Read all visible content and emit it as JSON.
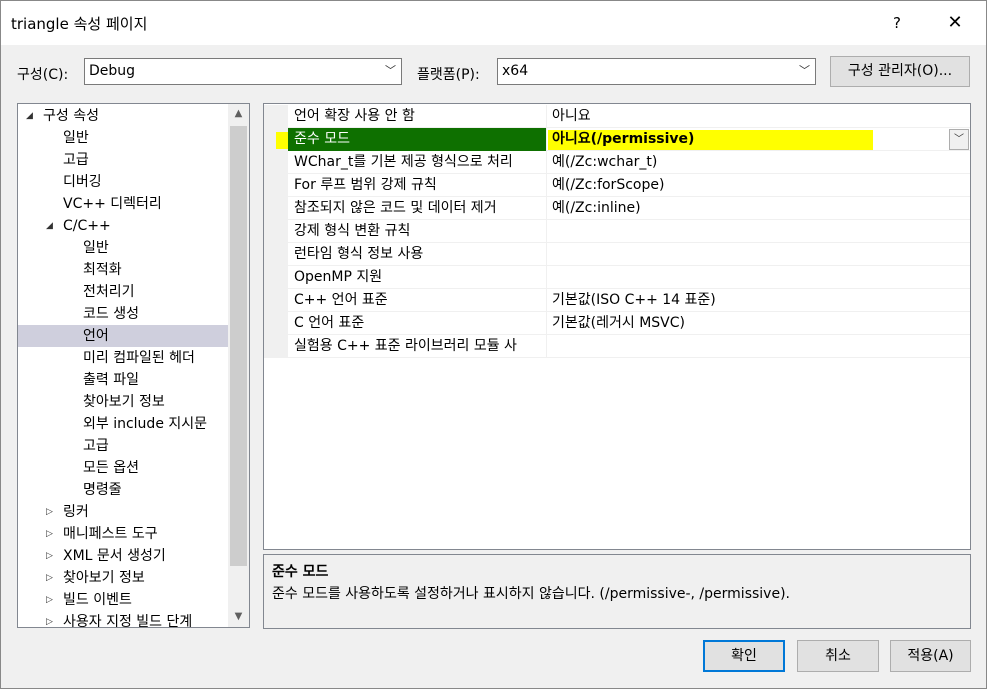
{
  "window": {
    "title": "triangle 속성 페이지",
    "help_label": "?",
    "close_label": "✕"
  },
  "config_bar": {
    "config_label": "구성(C):",
    "config_value": "Debug",
    "platform_label": "플랫폼(P):",
    "platform_value": "x64",
    "manager_button": "구성 관리자(O)..."
  },
  "tree": {
    "items": [
      {
        "label": "구성 속성",
        "level": 0,
        "expander": "◢"
      },
      {
        "label": "일반",
        "level": 1,
        "expander": ""
      },
      {
        "label": "고급",
        "level": 1,
        "expander": ""
      },
      {
        "label": "디버깅",
        "level": 1,
        "expander": ""
      },
      {
        "label": "VC++ 디렉터리",
        "level": 1,
        "expander": ""
      },
      {
        "label": "C/C++",
        "level": 1,
        "expander": "◢"
      },
      {
        "label": "일반",
        "level": 2,
        "expander": ""
      },
      {
        "label": "최적화",
        "level": 2,
        "expander": ""
      },
      {
        "label": "전처리기",
        "level": 2,
        "expander": ""
      },
      {
        "label": "코드 생성",
        "level": 2,
        "expander": ""
      },
      {
        "label": "언어",
        "level": 2,
        "expander": "",
        "selected": true
      },
      {
        "label": "미리 컴파일된 헤더",
        "level": 2,
        "expander": ""
      },
      {
        "label": "출력 파일",
        "level": 2,
        "expander": ""
      },
      {
        "label": "찾아보기 정보",
        "level": 2,
        "expander": ""
      },
      {
        "label": "외부 include 지시문",
        "level": 2,
        "expander": ""
      },
      {
        "label": "고급",
        "level": 2,
        "expander": ""
      },
      {
        "label": "모든 옵션",
        "level": 2,
        "expander": ""
      },
      {
        "label": "명령줄",
        "level": 2,
        "expander": ""
      },
      {
        "label": "링커",
        "level": 1,
        "expander": "▷"
      },
      {
        "label": "매니페스트 도구",
        "level": 1,
        "expander": "▷"
      },
      {
        "label": "XML 문서 생성기",
        "level": 1,
        "expander": "▷"
      },
      {
        "label": "찾아보기 정보",
        "level": 1,
        "expander": "▷"
      },
      {
        "label": "빌드 이벤트",
        "level": 1,
        "expander": "▷"
      },
      {
        "label": "사용자 지정 빌드 단계",
        "level": 1,
        "expander": "▷"
      }
    ]
  },
  "properties": {
    "rows": [
      {
        "name": "언어 확장 사용 안 함",
        "value": "아니요"
      },
      {
        "name": "준수 모드",
        "value": "아니요(/permissive)",
        "selected": true
      },
      {
        "name": "WChar_t를 기본 제공 형식으로 처리",
        "value": "예(/Zc:wchar_t)"
      },
      {
        "name": "For 루프 범위 강제 규칙",
        "value": "예(/Zc:forScope)"
      },
      {
        "name": "참조되지 않은 코드 및 데이터 제거",
        "value": "예(/Zc:inline)"
      },
      {
        "name": "강제 형식 변환 규칙",
        "value": ""
      },
      {
        "name": "런타임 형식 정보 사용",
        "value": ""
      },
      {
        "name": "OpenMP 지원",
        "value": ""
      },
      {
        "name": "C++ 언어 표준",
        "value": "기본값(ISO C++ 14 표준)"
      },
      {
        "name": "C 언어 표준",
        "value": "기본값(레거시 MSVC)"
      },
      {
        "name": "실험용 C++ 표준 라이브러리 모듈 사",
        "value": ""
      }
    ]
  },
  "description": {
    "title": "준수 모드",
    "text": "준수 모드를 사용하도록 설정하거나 표시하지 않습니다. (/permissive-, /permissive)."
  },
  "buttons": {
    "ok": "확인",
    "cancel": "취소",
    "apply": "적용(A)"
  },
  "colors": {
    "selected_name_bg": "#0e7000",
    "highlight": "#ffff00",
    "tree_selected": "#cfcfdd",
    "default_button_border": "#0078d7"
  }
}
